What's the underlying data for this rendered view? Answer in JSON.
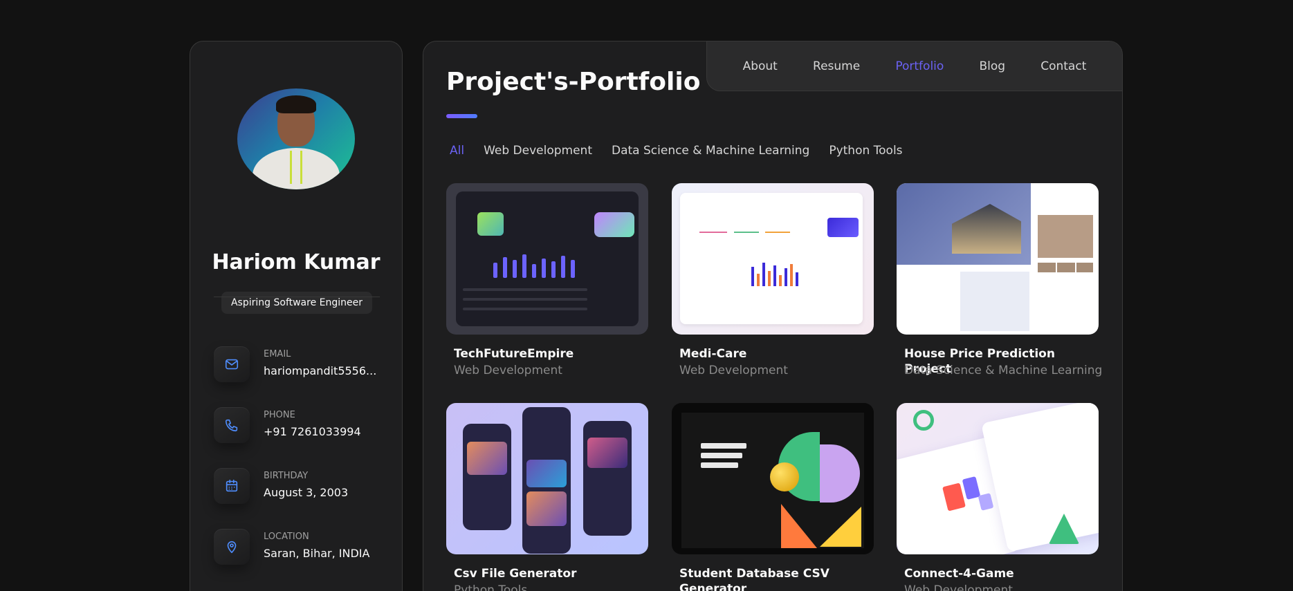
{
  "profile": {
    "name": "Hariom Kumar",
    "title": "Aspiring Software Engineer"
  },
  "contacts": [
    {
      "label": "EMAIL",
      "value": "hariompandit5556...",
      "icon": "mail-icon"
    },
    {
      "label": "PHONE",
      "value": "+91 7261033994",
      "icon": "phone-icon"
    },
    {
      "label": "BIRTHDAY",
      "value": "August 3, 2003",
      "icon": "calendar-icon"
    },
    {
      "label": "LOCATION",
      "value": "Saran, Bihar, INDIA",
      "icon": "location-pin-icon"
    }
  ],
  "nav": {
    "items": [
      {
        "label": "About"
      },
      {
        "label": "Resume"
      },
      {
        "label": "Portfolio",
        "active": true
      },
      {
        "label": "Blog"
      },
      {
        "label": "Contact"
      }
    ]
  },
  "page": {
    "title": "Project's-Portfolio"
  },
  "filters": {
    "items": [
      {
        "label": "All",
        "active": true
      },
      {
        "label": "Web Development"
      },
      {
        "label": "Data Science & Machine Learning"
      },
      {
        "label": "Python Tools"
      }
    ]
  },
  "projects": [
    {
      "title": "TechFutureEmpire",
      "category": "Web Development"
    },
    {
      "title": "Medi-Care",
      "category": "Web Development"
    },
    {
      "title": "House Price Prediction Project",
      "category": "Data Science & Machine Learning"
    },
    {
      "title": "Csv File Generator",
      "category": "Python Tools"
    },
    {
      "title": "Student Database CSV Generator",
      "category": ""
    },
    {
      "title": "Connect-4-Game",
      "category": "Web Development"
    }
  ],
  "colors": {
    "accent": "#6b62f4",
    "background": "#121212",
    "panel": "#1e1e1f",
    "icon": "#4f8dfd"
  }
}
